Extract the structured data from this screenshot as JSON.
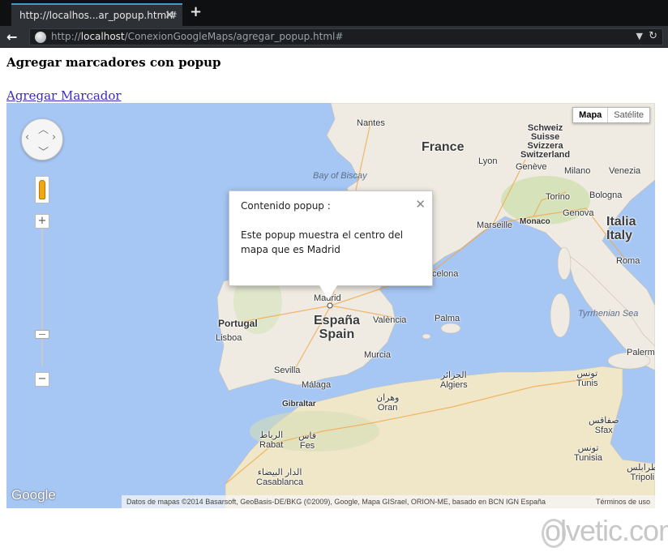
{
  "browser": {
    "tab_title": "http://localhos...ar_popup.html#",
    "tab_close": "✕",
    "new_tab": "+",
    "url_prefix": "http://",
    "url_host": "localhost",
    "url_path": "/ConexionGoogleMaps/agregar_popup.html#",
    "back": "←",
    "dropdown": "▼",
    "reload": "↻"
  },
  "page": {
    "title": "Agregar marcadores con popup",
    "link_label": "Agregar Marcador"
  },
  "map": {
    "type_controls": [
      "Mapa",
      "Satélite"
    ],
    "selected_type": "Mapa",
    "zoom_in": "+",
    "zoom_out": "−",
    "popup": {
      "title": "Contenido popup :",
      "body": "Este popup muestra el centro del mapa que es Madrid",
      "close": "✕"
    },
    "labels": {
      "nantes": "Nantes",
      "france": "France",
      "schweiz": "Schweiz",
      "suisse": "Suisse",
      "svizzera": "Svizzera",
      "switzerland": "Switzerland",
      "bay_of_biscay": "Bay of Biscay",
      "lyon": "Lyon",
      "geneve": "Genève",
      "milano": "Milano",
      "venezia": "Venezia",
      "torino": "Torino",
      "bologna": "Bologna",
      "marseille": "Marseille",
      "monaco": "Monaco",
      "genova": "Genova",
      "italia": "Italia",
      "italy": "Italy",
      "barcelona": "celona",
      "roma": "Roma",
      "madrid": "Madrid",
      "portugal": "Portugal",
      "lisboa": "Lisboa",
      "espana": "España",
      "spain": "Spain",
      "valencia": "València",
      "palma": "Palma",
      "tyrrhenian_sea": "Tyrrhenian Sea",
      "murcia": "Murcia",
      "palermo": "Palerm",
      "sevilla": "Sevilla",
      "malaga": "Málaga",
      "algiers_ar": "الجزائر",
      "algiers": "Algiers",
      "tunis_ar": "تونس",
      "tunis": "Tunis",
      "gibraltar": "Gibraltar",
      "oran_ar": "وهران",
      "oran": "Oran",
      "sfax_ar": "صفاقس",
      "sfax": "Sfax",
      "rabat_ar": "الرباط",
      "rabat": "Rabat",
      "fes_ar": "فاس",
      "fes": "Fes",
      "tunisia_ar": "تونس",
      "tunisia": "Tunisia",
      "casablanca_ar": "الدار البيضاء",
      "casablanca": "Casablanca",
      "tripoli_ar": "طرابلس",
      "tripoli": "Tripoli"
    },
    "google_logo": "Google",
    "attribution": "Datos de mapas ©2014 Basarsoft, GeoBasis-DE/BKG (©2009), Google, Mapa GISrael, ORION-ME, basado en BCN IGN España",
    "terms": "Términos de uso"
  },
  "watermark": "olvetic.com",
  "colors": {
    "water": "#a6c6f3",
    "land": "#efebe2",
    "link": "#3a2bbd",
    "tab_accent": "#3d9bd6"
  }
}
